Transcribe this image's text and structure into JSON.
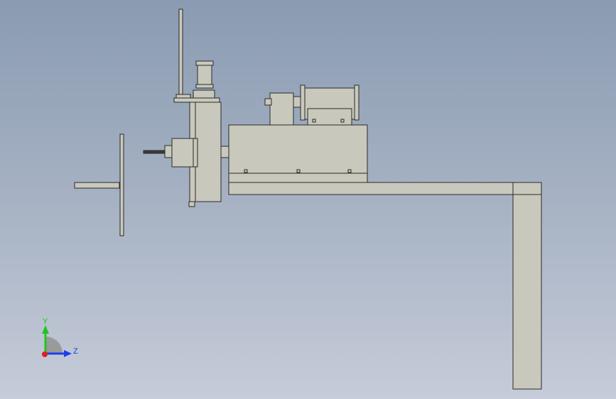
{
  "viewport": {
    "background_top": "#8a9bb2",
    "background_bottom": "#c6ccd9",
    "part_fill": "#c8c8bc",
    "edge_color": "#2a2a2a"
  },
  "triad": {
    "x_label": "",
    "y_label": "Y",
    "z_label": "Z",
    "y_color": "#22c322",
    "z_color": "#1f3fe6",
    "x_color": "#e21f1f"
  }
}
